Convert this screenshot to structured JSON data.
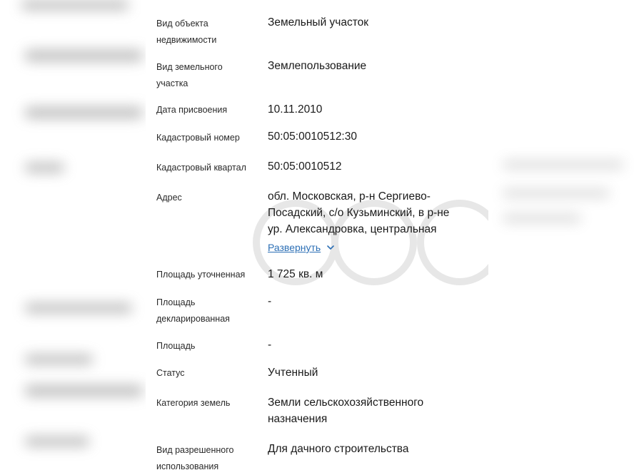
{
  "details": {
    "object_type": {
      "label": "Вид объекта недвижимости",
      "value": "Земельный участок"
    },
    "land_type": {
      "label": "Вид земельного участка",
      "value": "Землепользование"
    },
    "assign_date": {
      "label": "Дата присвоения",
      "value": "10.11.2010"
    },
    "cadastral_number": {
      "label": "Кадастровый номер",
      "value": "50:05:0010512:30"
    },
    "cadastral_block": {
      "label": "Кадастровый квартал",
      "value": "50:05:0010512"
    },
    "address": {
      "label": "Адрес",
      "line1": "обл. Московская, р-н Сергиево-",
      "line2": "Посадский, с/о Кузьминский, в р-не",
      "line3": "ур. Александровка, центральная",
      "expand_label": "Развернуть"
    },
    "area_refined": {
      "label": "Площадь уточненная",
      "value": "1 725 кв. м"
    },
    "area_declared": {
      "label": "Площадь декларированная",
      "value": "-"
    },
    "area": {
      "label": "Площадь",
      "value": "-"
    },
    "status": {
      "label": "Статус",
      "value": "Учтенный"
    },
    "land_category": {
      "label": "Категория земель",
      "value_line1": "Земли сельскохозяйственного",
      "value_line2": "назначения"
    },
    "permitted_use": {
      "label": "Вид разрешенного использования",
      "value": "Для дачного строительства"
    }
  },
  "colors": {
    "link": "#2c6fb5",
    "text": "#1a1a1a",
    "label": "#2a2a2a"
  },
  "icons": {
    "expand": "chevron-down-icon"
  }
}
